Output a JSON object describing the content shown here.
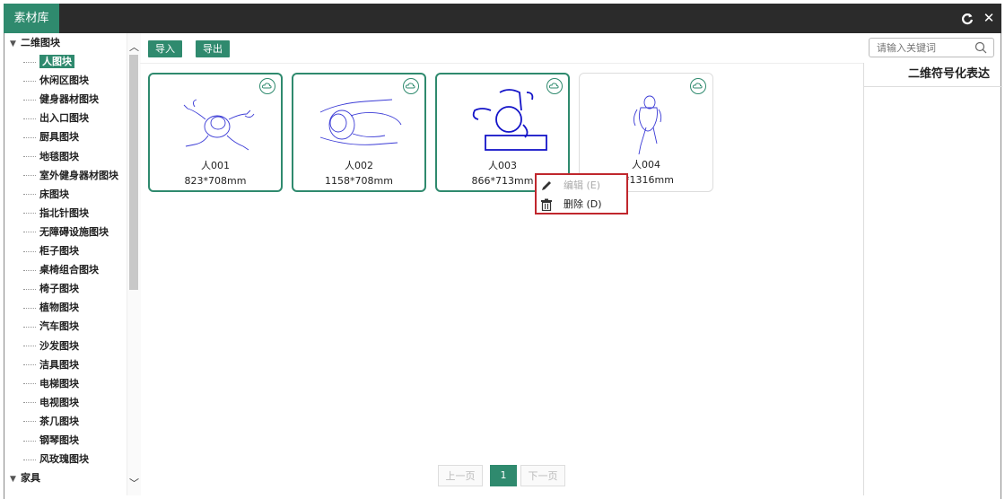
{
  "window": {
    "tab": "素材库"
  },
  "toolbar": {
    "import": "导入",
    "export": "导出",
    "search_placeholder": "请输入关键词"
  },
  "tree": {
    "root": "二维图块",
    "items": [
      "人图块",
      "休闲区图块",
      "健身器材图块",
      "出入口图块",
      "厨具图块",
      "地毯图块",
      "室外健身器材图块",
      "床图块",
      "指北针图块",
      "无障碍设施图块",
      "柜子图块",
      "桌椅组合图块",
      "椅子图块",
      "植物图块",
      "汽车图块",
      "沙发图块",
      "洁具图块",
      "电梯图块",
      "电视图块",
      "茶几图块",
      "钢琴图块",
      "风玫瑰图块"
    ],
    "selected_index": 0,
    "second_root": "家具"
  },
  "right_panel": {
    "title": "二维符号化表达"
  },
  "cards": [
    {
      "name": "人001",
      "size": "823*708mm"
    },
    {
      "name": "人002",
      "size": "1158*708mm"
    },
    {
      "name": "人003",
      "size": "866*713mm"
    },
    {
      "name": "人004",
      "size": "9*1316mm"
    }
  ],
  "context_menu": {
    "edit": "编辑 (E)",
    "delete": "删除 (D)"
  },
  "pager": {
    "prev": "上一页",
    "current": "1",
    "next": "下一页"
  },
  "colors": {
    "accent": "#2f8a6e",
    "highlight": "#c0272d",
    "drawing": "#3b3bd6"
  }
}
